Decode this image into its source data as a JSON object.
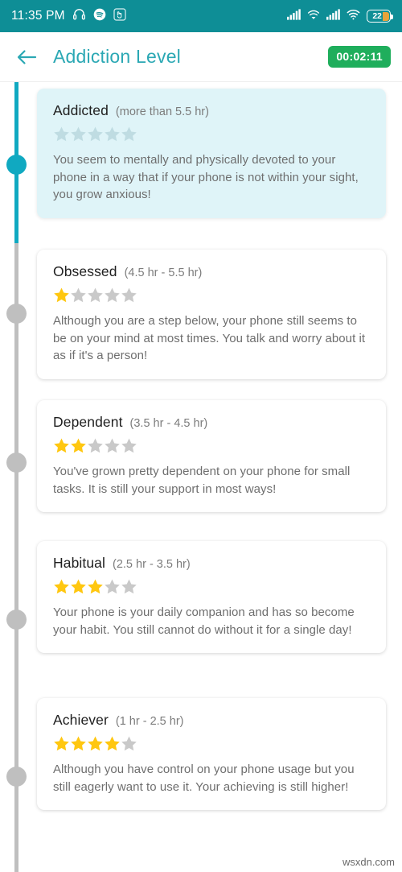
{
  "statusbar": {
    "time": "11:35 PM",
    "battery_text": "22",
    "icons": [
      "headphones-icon",
      "spotify-icon",
      "touch-assist-icon",
      "signal-bars-icon",
      "wifi-calling-icon",
      "signal-bars-2-icon",
      "wifi-icon",
      "battery-icon"
    ],
    "bg_color": "#0E8E96"
  },
  "header": {
    "back_label": "back-arrow",
    "title": "Addiction Level",
    "timer": "00:02:11",
    "title_color": "#2BA8B4",
    "timer_bg": "#1FAE5C"
  },
  "timeline": {
    "active_color": "#10A9C1",
    "inactive_color": "#BFBFBF",
    "active_index": 0
  },
  "levels": [
    {
      "name": "Addicted",
      "range": "(more than 5.5 hr)",
      "stars_filled": 0,
      "stars_total": 5,
      "description": "You seem to mentally and physically devoted to your phone in a way that if your phone is not within your sight, you grow anxious!",
      "highlighted": true
    },
    {
      "name": "Obsessed",
      "range": "(4.5 hr - 5.5 hr)",
      "stars_filled": 1,
      "stars_total": 5,
      "description": "Although you are a step below, your phone still seems to be on your mind at most times. You talk and worry about it as if it's a person!",
      "highlighted": false
    },
    {
      "name": "Dependent",
      "range": "(3.5 hr - 4.5 hr)",
      "stars_filled": 2,
      "stars_total": 5,
      "description": "You've grown pretty dependent on your phone for small tasks. It is still your support in most ways!",
      "highlighted": false
    },
    {
      "name": "Habitual",
      "range": "(2.5 hr - 3.5 hr)",
      "stars_filled": 3,
      "stars_total": 5,
      "description": "Your phone is your daily companion and has so become your habit. You still cannot do without it for a single day!",
      "highlighted": false
    },
    {
      "name": "Achiever",
      "range": "(1 hr - 2.5 hr)",
      "stars_filled": 4,
      "stars_total": 5,
      "description": "Although you have control on your phone usage but you still eagerly want to use it. Your achieving is still higher!",
      "highlighted": false
    }
  ],
  "star_colors": {
    "filled": "#FFC710",
    "empty": "#C9C9C9",
    "empty_on_highlight": "#BFDCE2"
  },
  "watermark": "wsxdn.com"
}
